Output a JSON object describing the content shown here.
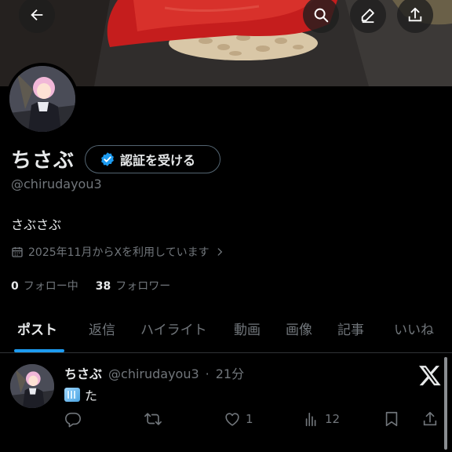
{
  "profile": {
    "display_name": "ちさぶ",
    "verify_label": "認証を受ける",
    "handle": "@chirudayou3",
    "bio": "さぶさぶ",
    "joined": "2025年11月からXを利用しています",
    "following_count": "0",
    "following_label": "フォロー中",
    "followers_count": "38",
    "followers_label": "フォロワー"
  },
  "tabs": [
    {
      "label": "ポスト",
      "active": true
    },
    {
      "label": "返信"
    },
    {
      "label": "ハイライト"
    },
    {
      "label": "動画"
    },
    {
      "label": "画像"
    },
    {
      "label": "記事"
    },
    {
      "label": "いいね"
    }
  ],
  "post": {
    "name": "ちさぶ",
    "handle": "@chirudayou3",
    "separator": "·",
    "time": "21分",
    "text": "た",
    "likes": "1",
    "views": "12"
  },
  "colors": {
    "accent": "#1d9bf0",
    "text": "#e7e9ea",
    "muted": "#71767b",
    "background": "#000000"
  },
  "icons": [
    "back-arrow-icon",
    "search-icon",
    "edit-icon",
    "share-icon",
    "verified-badge-icon",
    "calendar-icon",
    "chevron-right-icon",
    "reply-icon",
    "retweet-icon",
    "like-icon",
    "views-icon",
    "bookmark-icon",
    "x-logo-icon"
  ]
}
